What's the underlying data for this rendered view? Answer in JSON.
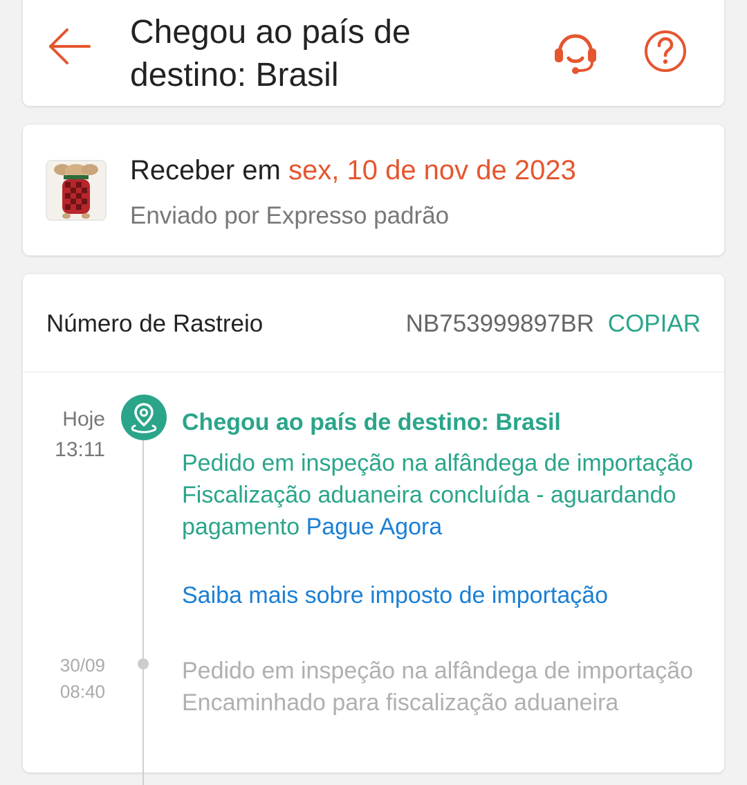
{
  "header": {
    "title": "Chegou ao país de destino: Brasil",
    "icons": {
      "back": "arrow-left-icon",
      "support": "headset-icon",
      "help": "question-circle-icon"
    },
    "accent_color": "#e5562f"
  },
  "delivery": {
    "receive_prefix": "Receber em",
    "receive_date": "sex, 10 de nov de 2023",
    "shipped_by": "Enviado por Expresso padrão",
    "date_color": "#e5562f"
  },
  "tracking": {
    "label": "Número de Rastreio",
    "number": "NB753999897BR",
    "copy_label": "COPIAR",
    "accent_color": "#2aa58a",
    "link_color": "#1a7fd4"
  },
  "events": [
    {
      "day": "Hoje",
      "time": "13:11",
      "icon": "location-pin-icon",
      "title": "Chegou ao país de destino: Brasil",
      "description": "Pedido em inspeção na alfândega de importação Fiscalização aduaneira concluída - aguardando pagamento",
      "pay_link": "Pague Agora",
      "learn_link": "Saiba mais sobre imposto de importação"
    },
    {
      "day": "30/09",
      "time": "08:40",
      "description": "Pedido em inspeção na alfândega de importação Encaminhado para fiscalização aduaneira"
    }
  ]
}
